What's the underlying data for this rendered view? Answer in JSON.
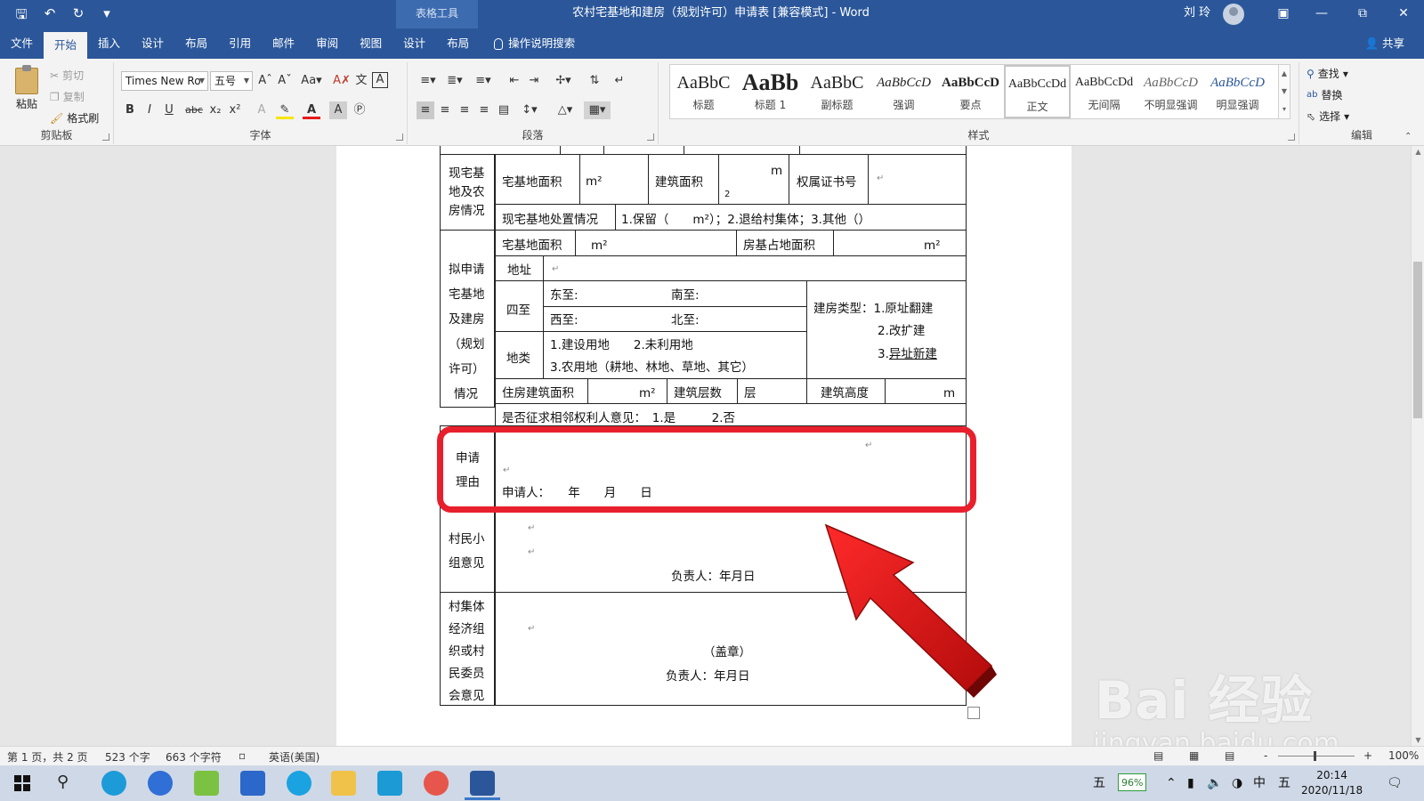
{
  "window": {
    "title": "农村宅基地和建房（规划许可）申请表 [兼容模式] - Word",
    "context_tab": "表格工具",
    "user": "刘 玲",
    "accent": "#2b579a"
  },
  "tabs": [
    "文件",
    "开始",
    "插入",
    "设计",
    "布局",
    "引用",
    "邮件",
    "审阅",
    "视图",
    "设计",
    "布局"
  ],
  "active_tab": "开始",
  "tell_me": "操作说明搜索",
  "share": "共享",
  "ribbon": {
    "clipboard": {
      "paste": "粘贴",
      "cut": "剪切",
      "copy": "复制",
      "format_painter": "格式刷",
      "label": "剪贴板"
    },
    "font": {
      "family": "Times New Ro",
      "size": "五号",
      "label": "字体",
      "case": "Aa"
    },
    "paragraph": {
      "label": "段落"
    },
    "styles": {
      "label": "样式",
      "items": [
        {
          "sample": "AaBbC",
          "name": "标题"
        },
        {
          "sample": "AaBb",
          "name": "标题 1"
        },
        {
          "sample": "AaBbC",
          "name": "副标题"
        },
        {
          "sample": "AaBbCcD",
          "name": "强调"
        },
        {
          "sample": "AaBbCcD",
          "name": "要点"
        },
        {
          "sample": "AaBbCcDd",
          "name": "正文"
        },
        {
          "sample": "AaBbCcDd",
          "name": "无间隔"
        },
        {
          "sample": "AaBbCcD",
          "name": "不明显强调"
        },
        {
          "sample": "AaBbCcD",
          "name": "明显强调"
        }
      ]
    },
    "editing": {
      "label": "编辑",
      "find": "查找",
      "replace": "替换",
      "select": "选择"
    }
  },
  "form": {
    "row1_label": [
      "现宅基",
      "地及农",
      "房情况"
    ],
    "homestead_area": "宅基地面积",
    "m2": "m²",
    "building_area": "建筑面积",
    "m": "m",
    "sq": "2",
    "cert_no": "权属证书号",
    "disposal": "现宅基地处置情况",
    "disposal_options": "1.保留（　　m²）；2.退给村集体；3.其他（）",
    "row2_label": [
      "拟申请",
      "宅基地",
      "及建房",
      "（规划",
      "许可）",
      "情况"
    ],
    "house_base_area": "房基占地面积",
    "address": "地址",
    "four_bounds": "四至",
    "east": "东至:",
    "south": "南至:",
    "west": "西至:",
    "north": "北至:",
    "land_type": "地类",
    "land_type_1": "1.建设用地　　2.未利用地",
    "land_type_2": "3.农用地（耕地、林地、草地、其它）",
    "build_type": "建房类型：1.原址翻建",
    "build_type_2": "2.改扩建",
    "build_type_3_prefix": "3.",
    "build_type_3": "异址新建",
    "house_area": "住房建筑面积",
    "floors": "建筑层数",
    "floor_unit": "层",
    "height": "建筑高度",
    "neighbor_opinion": "是否征求相邻权利人意见：　1.是　　　2.否",
    "reason_label": [
      "申请",
      "理由"
    ],
    "applicant": "申请人：　　年　　月　　日",
    "group_label": [
      "村民小",
      "组意见"
    ],
    "responsible": "负责人：年月日",
    "collective_label": [
      "村集体",
      "经济组",
      "织或村",
      "民委员",
      "会意见"
    ],
    "seal": "（盖章）"
  },
  "status": {
    "page": "第 1 页，共 2 页",
    "words": "523 个字",
    "chars": "663 个字符",
    "language": "英语(美国)",
    "zoom": "100%",
    "zoom_minus": "-",
    "zoom_plus": "+"
  },
  "taskbar": {
    "battery": "96%",
    "ime": "中",
    "ime2": "五",
    "time": "20:14",
    "date": "2020/11/18"
  },
  "watermark": {
    "main": "Bai 经验",
    "sub": "jingyan.baidu.com"
  },
  "colors": {
    "highlight": "#e8202d",
    "arrow": "#e01818"
  }
}
